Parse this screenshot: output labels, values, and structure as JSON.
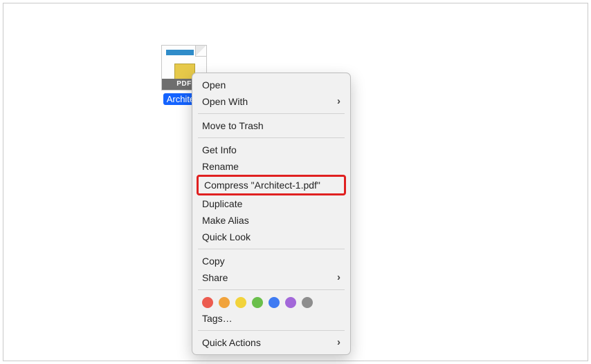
{
  "file": {
    "label": "Architect",
    "badge": "PDF"
  },
  "menu": {
    "open": "Open",
    "open_with": "Open With",
    "move_to_trash": "Move to Trash",
    "get_info": "Get Info",
    "rename": "Rename",
    "compress": "Compress \"Architect-1.pdf\"",
    "duplicate": "Duplicate",
    "make_alias": "Make Alias",
    "quick_look": "Quick Look",
    "copy": "Copy",
    "share": "Share",
    "tags": "Tags…",
    "quick_actions": "Quick Actions"
  },
  "tag_colors": {
    "red": "#ec5b4f",
    "orange": "#f1a33c",
    "yellow": "#f2d33b",
    "green": "#6abf4b",
    "blue": "#3f7bf2",
    "purple": "#a368d9",
    "gray": "#8e8e8e"
  }
}
